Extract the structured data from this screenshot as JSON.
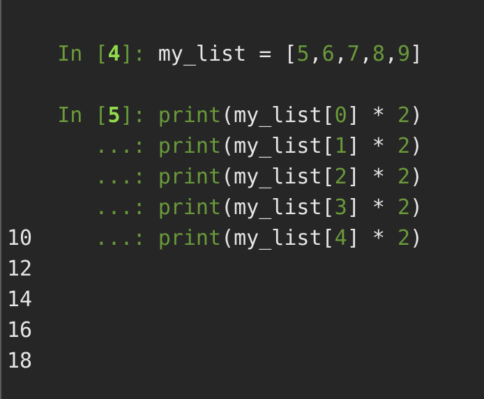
{
  "cells": [
    {
      "in_prefix": "In [",
      "number": "4",
      "in_suffix": "]: ",
      "lines": [
        {
          "code_before": "my_list = [",
          "literals": [
            "5",
            "6",
            "7",
            "8",
            "9"
          ],
          "code_after": "]"
        }
      ]
    },
    {
      "in_prefix": "In [",
      "number": "5",
      "in_suffix": "]: ",
      "continuation_prompt": "   ...: ",
      "lines": [
        {
          "fn": "print",
          "arg_pre": "(my_list[",
          "index": "0",
          "arg_mid": "] * ",
          "factor": "2",
          "arg_post": ")"
        },
        {
          "fn": "print",
          "arg_pre": "(my_list[",
          "index": "1",
          "arg_mid": "] * ",
          "factor": "2",
          "arg_post": ")"
        },
        {
          "fn": "print",
          "arg_pre": "(my_list[",
          "index": "2",
          "arg_mid": "] * ",
          "factor": "2",
          "arg_post": ")"
        },
        {
          "fn": "print",
          "arg_pre": "(my_list[",
          "index": "3",
          "arg_mid": "] * ",
          "factor": "2",
          "arg_post": ")"
        },
        {
          "fn": "print",
          "arg_pre": "(my_list[",
          "index": "4",
          "arg_mid": "] * ",
          "factor": "2",
          "arg_post": ")"
        }
      ],
      "output": [
        "10",
        "12",
        "14",
        "16",
        "18"
      ]
    }
  ],
  "colors": {
    "background": "#262626",
    "prompt_green": "#6a9a3a",
    "prompt_number": "#93d94e",
    "text": "#e6e6e6"
  }
}
